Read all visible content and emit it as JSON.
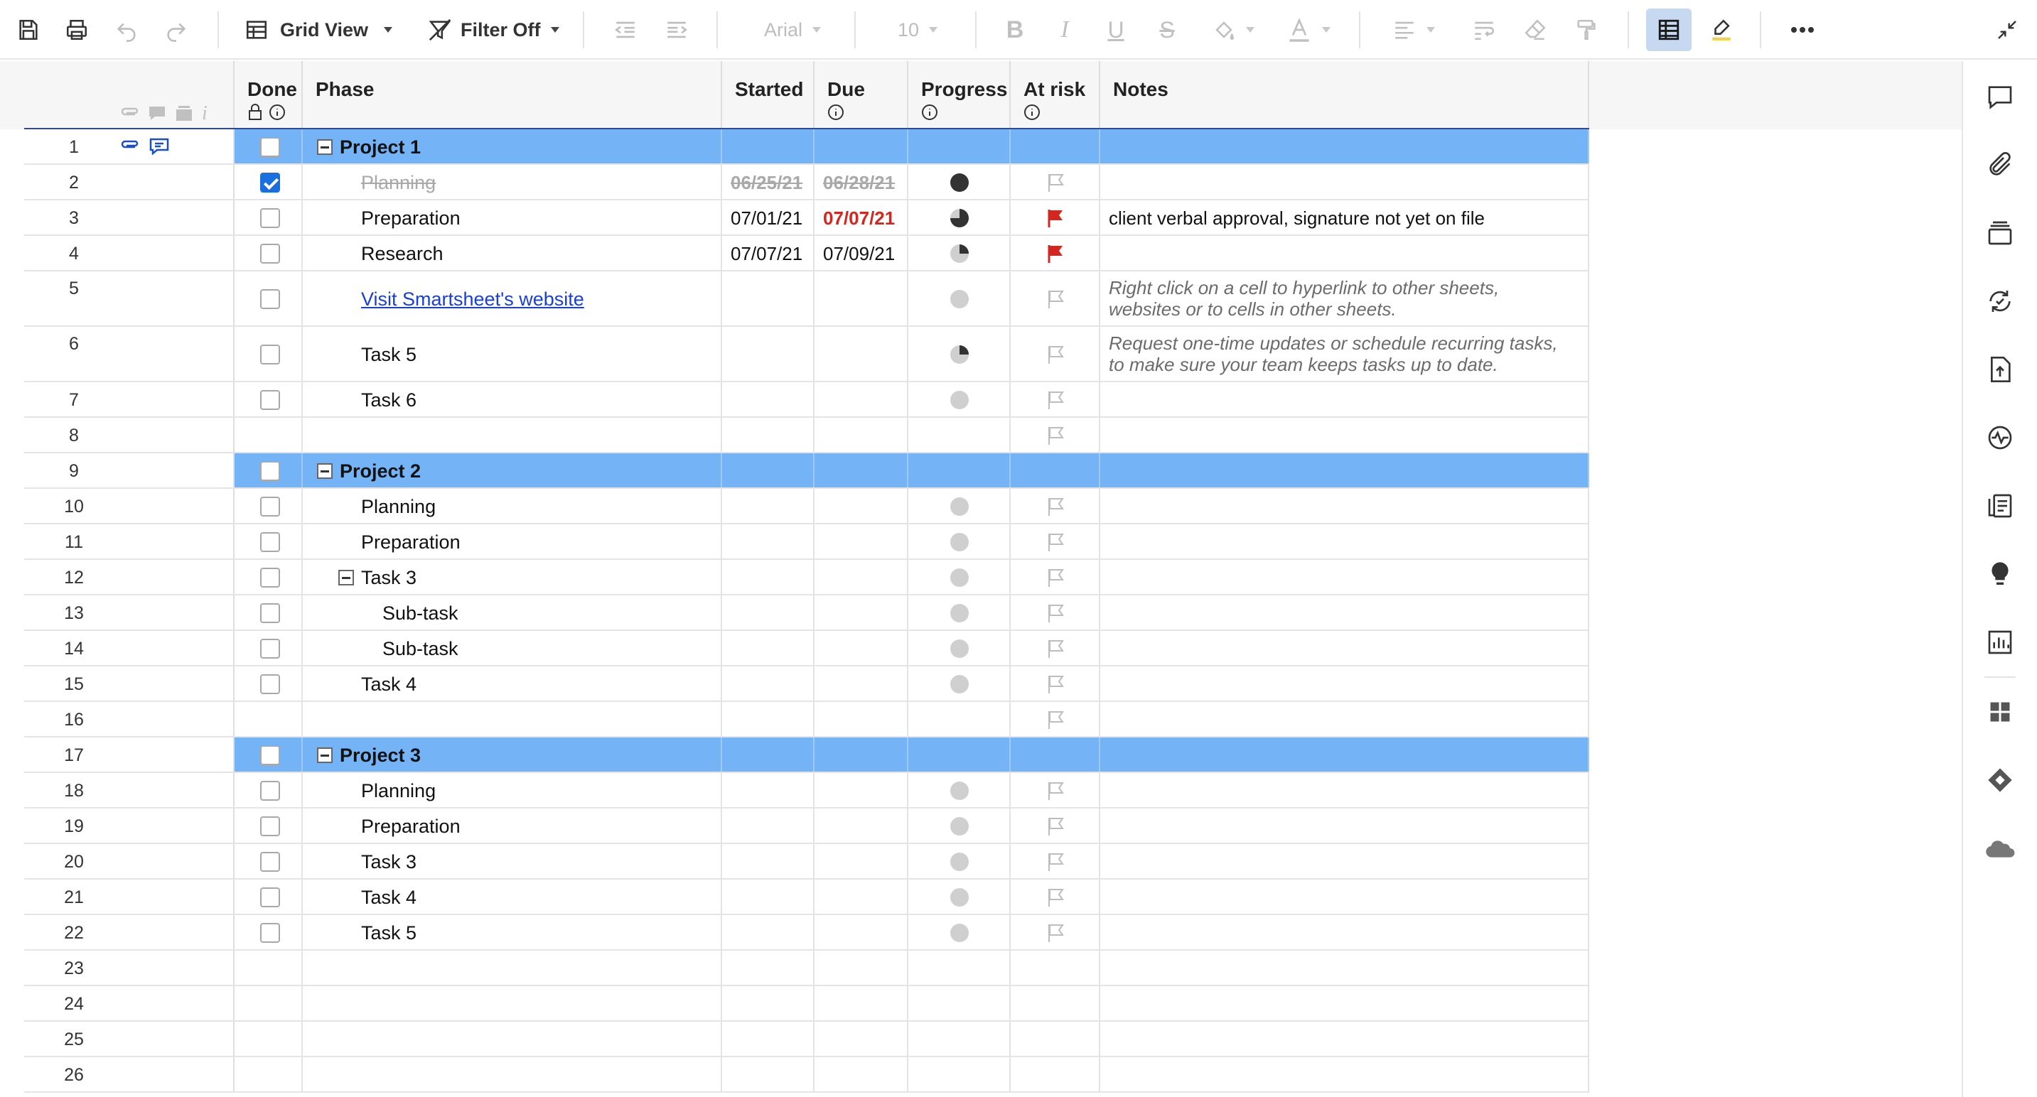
{
  "toolbar": {
    "view_label": "Grid View",
    "filter_label": "Filter Off",
    "font_name": "Arial",
    "font_size": "10"
  },
  "columns": {
    "done": "Done",
    "phase": "Phase",
    "started": "Started",
    "due": "Due",
    "progress": "Progress",
    "at_risk": "At risk",
    "notes": "Notes"
  },
  "rows": [
    {
      "n": "1",
      "type": "parent",
      "phase": "Project 1",
      "done": false,
      "icons": true
    },
    {
      "n": "2",
      "type": "task",
      "phase": "Planning",
      "done": true,
      "started": "06/25/21",
      "due": "06/28/21",
      "progress": "full",
      "flag": "off",
      "style": "strike",
      "indent": 1
    },
    {
      "n": "3",
      "type": "task",
      "phase": "Preparation",
      "done": false,
      "started": "07/01/21",
      "due": "07/07/21",
      "due_style": "red",
      "progress": "three-quarter",
      "flag": "on",
      "note": "client verbal approval, signature not yet on file",
      "indent": 1
    },
    {
      "n": "4",
      "type": "task",
      "phase": "Research",
      "done": false,
      "started": "07/07/21",
      "due": "07/09/21",
      "progress": "quarter",
      "flag": "on",
      "indent": 1
    },
    {
      "n": "5",
      "type": "task",
      "phase": "Visit Smartsheet's website",
      "done": false,
      "progress": "empty",
      "flag": "off",
      "style": "link",
      "note1": "Right click on a cell to hyperlink to other sheets,",
      "note2": "websites or to cells in other sheets.",
      "tall": true,
      "indent": 1
    },
    {
      "n": "6",
      "type": "task",
      "phase": "Task 5",
      "done": false,
      "progress": "quarter",
      "flag": "off",
      "note1": "Request one-time updates or schedule recurring tasks,",
      "note2": "to make sure your team keeps tasks up to date.",
      "tall": true,
      "indent": 1
    },
    {
      "n": "7",
      "type": "task",
      "phase": "Task 6",
      "done": false,
      "progress": "empty",
      "flag": "off",
      "indent": 1
    },
    {
      "n": "8",
      "type": "blank",
      "flag": "off"
    },
    {
      "n": "9",
      "type": "parent",
      "phase": "Project 2",
      "done": false
    },
    {
      "n": "10",
      "type": "task",
      "phase": "Planning",
      "done": false,
      "progress": "empty",
      "flag": "off",
      "indent": 1
    },
    {
      "n": "11",
      "type": "task",
      "phase": "Preparation",
      "done": false,
      "progress": "empty",
      "flag": "off",
      "indent": 1
    },
    {
      "n": "12",
      "type": "task",
      "phase": "Task 3",
      "done": false,
      "progress": "empty",
      "flag": "off",
      "indent": 1,
      "collapse": true
    },
    {
      "n": "13",
      "type": "task",
      "phase": "Sub-task",
      "done": false,
      "progress": "empty",
      "flag": "off",
      "indent": 2
    },
    {
      "n": "14",
      "type": "task",
      "phase": "Sub-task",
      "done": false,
      "progress": "empty",
      "flag": "off",
      "indent": 2
    },
    {
      "n": "15",
      "type": "task",
      "phase": "Task 4",
      "done": false,
      "progress": "empty",
      "flag": "off",
      "indent": 1
    },
    {
      "n": "16",
      "type": "blank",
      "flag": "off"
    },
    {
      "n": "17",
      "type": "parent",
      "phase": "Project 3",
      "done": false
    },
    {
      "n": "18",
      "type": "task",
      "phase": "Planning",
      "done": false,
      "progress": "empty",
      "flag": "off",
      "indent": 1
    },
    {
      "n": "19",
      "type": "task",
      "phase": "Preparation",
      "done": false,
      "progress": "empty",
      "flag": "off",
      "indent": 1
    },
    {
      "n": "20",
      "type": "task",
      "phase": "Task 3",
      "done": false,
      "progress": "empty",
      "flag": "off",
      "indent": 1
    },
    {
      "n": "21",
      "type": "task",
      "phase": "Task 4",
      "done": false,
      "progress": "empty",
      "flag": "off",
      "indent": 1
    },
    {
      "n": "22",
      "type": "task",
      "phase": "Task 5",
      "done": false,
      "progress": "empty",
      "flag": "off",
      "indent": 1
    },
    {
      "n": "23",
      "type": "empty"
    },
    {
      "n": "24",
      "type": "empty"
    },
    {
      "n": "25",
      "type": "empty"
    },
    {
      "n": "26",
      "type": "empty"
    }
  ],
  "colors": {
    "parent_row": "#74b3f5",
    "header_line": "#2f4a93",
    "checkbox_on": "#1a6fe0",
    "risk_flag": "#d3261e",
    "link": "#1a3fd6"
  }
}
